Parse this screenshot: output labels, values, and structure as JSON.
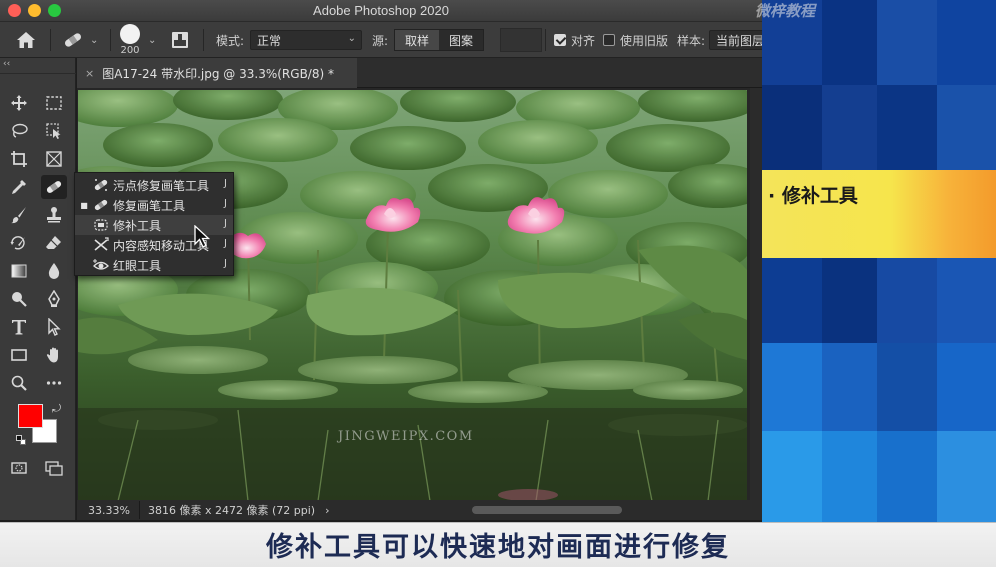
{
  "window": {
    "title": "Adobe Photoshop 2020"
  },
  "options_bar": {
    "brush_size": "200",
    "mode_label": "模式:",
    "mode_value": "正常",
    "source_label": "源:",
    "source_options": [
      "取样",
      "图案"
    ],
    "source_selected": "取样",
    "aligned_label": "对齐",
    "aligned_checked": true,
    "legacy_label": "使用旧版",
    "legacy_checked": false,
    "sample_label": "样本:",
    "sample_value": "当前图层"
  },
  "document": {
    "tab_title": "图A17-24 带水印.jpg @ 33.3%(RGB/8) *",
    "close_glyph": "×",
    "watermark_text": "JINGWEIPX.COM"
  },
  "status": {
    "zoom": "33.33%",
    "doc_info": "3816 像素 x 2472 像素 (72 ppi)",
    "arrow": "›"
  },
  "tool_flyout": {
    "items": [
      {
        "label": "污点修复画笔工具",
        "shortcut": "J",
        "icon": "spot-healing-brush-icon",
        "selected": false
      },
      {
        "label": "修复画笔工具",
        "shortcut": "J",
        "icon": "healing-brush-icon",
        "selected": true
      },
      {
        "label": "修补工具",
        "shortcut": "J",
        "icon": "patch-tool-icon",
        "selected": false
      },
      {
        "label": "内容感知移动工具",
        "shortcut": "J",
        "icon": "content-aware-move-icon",
        "selected": false
      },
      {
        "label": "红眼工具",
        "shortcut": "J",
        "icon": "red-eye-icon",
        "selected": false
      }
    ]
  },
  "colors": {
    "foreground": "#ff0000",
    "background": "#ffffff"
  },
  "slide": {
    "heading": "· 修补工具",
    "watermark": "微梓教程"
  },
  "subtitle": "修补工具可以快速地对画面进行修复"
}
